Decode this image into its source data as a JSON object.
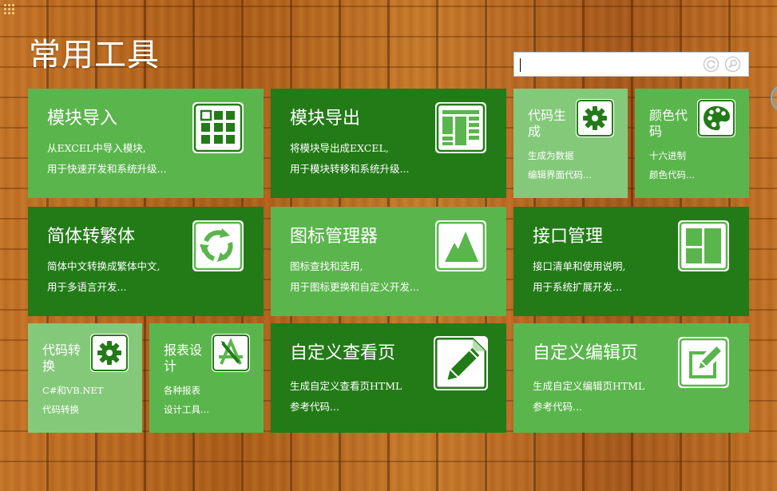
{
  "page": {
    "title": "常用工具"
  },
  "search": {
    "value": "",
    "placeholder": ""
  },
  "colors": {
    "tile_light": "#5bb54d",
    "tile_dark": "#237b18",
    "tile_pale": "#84c97a"
  },
  "tiles": [
    {
      "title": "模块导入",
      "desc1": "从EXCEL中导入模块,",
      "desc2": "用于快速开发和系统升级...",
      "icon": "grid-icon"
    },
    {
      "title": "模块导出",
      "desc1": "将模块导出成EXCEL,",
      "desc2": "用于模块转移和系统升级...",
      "icon": "spreadsheet-icon"
    },
    {
      "title": "代码生成",
      "desc1": "生成为数据",
      "desc2": "编辑界面代码...",
      "icon": "gear-icon"
    },
    {
      "title": "颜色代码",
      "desc1": "十六进制",
      "desc2": "颜色代码...",
      "icon": "palette-icon"
    },
    {
      "title": "简体转繁体",
      "desc1": "简体中文转换成繁体中文,",
      "desc2": "用于多语言开发...",
      "icon": "recycle-icon"
    },
    {
      "title": "图标管理器",
      "desc1": "图标查找和选用,",
      "desc2": "用于图标更换和自定义开发...",
      "icon": "mountain-icon"
    },
    {
      "title": "接口管理",
      "desc1": "接口清单和使用说明,",
      "desc2": "用于系统扩展开发...",
      "icon": "layout-icon"
    },
    {
      "title": "代码转换",
      "desc1": "C#和VB.NET",
      "desc2": "代码转换",
      "icon": "gear-icon"
    },
    {
      "title": "报表设计",
      "desc1": "各种报表",
      "desc2": "设计工具...",
      "icon": "design-tools-icon"
    },
    {
      "title": "自定义查看页",
      "desc1": "生成自定义查看页HTML",
      "desc2": "参考代码...",
      "icon": "pencil-document-icon"
    },
    {
      "title": "自定义编辑页",
      "desc1": "生成自定义编辑页HTML",
      "desc2": "参考代码...",
      "icon": "edit-icon"
    }
  ]
}
